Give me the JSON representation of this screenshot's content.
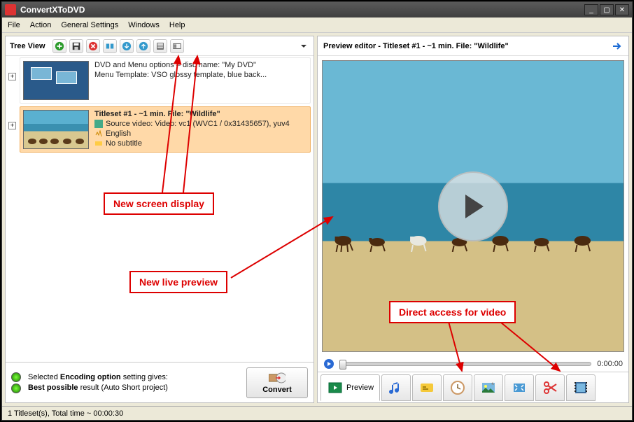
{
  "title": "ConvertXToDVD",
  "menu": {
    "file": "File",
    "action": "Action",
    "general": "General Settings",
    "windows": "Windows",
    "help": "Help"
  },
  "treeview": {
    "label": "Tree View",
    "dvd": {
      "line1": "DVD and Menu options – disc name: \"My DVD\"",
      "line2": "Menu Template: VSO glossy template, blue back..."
    },
    "title1": {
      "header": "Titleset #1 - ~1 min. File: \"Wildlife\"",
      "source": "Source video: Video: vc1 (WVC1 / 0x31435657), yuv4",
      "lang": "English",
      "sub": "No subtitle"
    }
  },
  "encoding": {
    "line1a": "Selected ",
    "line1b": "Encoding option",
    "line1c": " setting gives:",
    "line2a": "Best possible",
    "line2b": " result (Auto Short project)"
  },
  "convert": "Convert",
  "preview": {
    "header": "Preview editor - Titleset #1 - ~1 min. File: \"Wildlife\"",
    "time": "0:00:00",
    "tab_label": "Preview"
  },
  "callouts": {
    "c1": "New screen display",
    "c2": "New live preview",
    "c3": "Direct access for video"
  },
  "status": "1 Titleset(s), Total time ~ 00:00:30"
}
